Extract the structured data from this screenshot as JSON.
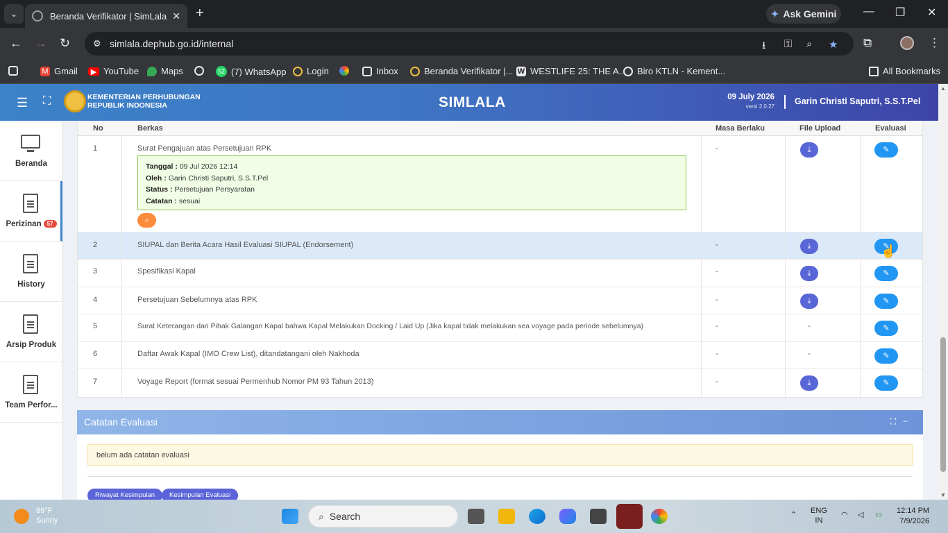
{
  "browser": {
    "tab_title": "Beranda Verifikator | SimLala",
    "new_tab": "+",
    "gemini_label": "Ask Gemini",
    "url": "simlala.dephub.go.id/internal",
    "bookmarks": [
      {
        "label": "Gmail"
      },
      {
        "label": "YouTube"
      },
      {
        "label": "Maps"
      },
      {
        "label": ""
      },
      {
        "label": "(7) WhatsApp"
      },
      {
        "label": "Login"
      },
      {
        "label": ""
      },
      {
        "label": "Inbox"
      },
      {
        "label": "Beranda Verifikator |..."
      },
      {
        "label": "WESTLIFE 25: THE A..."
      },
      {
        "label": "Biro KTLN - Kement..."
      }
    ],
    "all_bookmarks": "All Bookmarks"
  },
  "header": {
    "org_line1": "KEMENTERIAN PERHUBUNGAN",
    "org_line2": "REPUBLIK INDONESIA",
    "brand": "SIMLALA",
    "date": "09 July 2026",
    "version": "versi 2.0.27",
    "user": "Garin Christi Saputri, S.S.T.Pel"
  },
  "sidebar": {
    "items": [
      {
        "label": "Beranda"
      },
      {
        "label": "Perizinan",
        "badge": "57"
      },
      {
        "label": "History"
      },
      {
        "label": "Arsip Produk"
      },
      {
        "label": "Team Perfor..."
      }
    ]
  },
  "table": {
    "columns": [
      "No",
      "Berkas",
      "Masa Berlaku",
      "File Upload",
      "Evaluasi"
    ],
    "rows": [
      {
        "no": "1",
        "berkas": "Surat Pengajuan atas Persetujuan RPK",
        "masa": "-",
        "file": "download"
      },
      {
        "no": "2",
        "berkas": "SIUPAL dan Berita Acara Hasil Evaluasi SIUPAL (Endorsement)",
        "masa": "-",
        "file": "download"
      },
      {
        "no": "3",
        "berkas": "Spesifikasi Kapal",
        "masa": "-",
        "file": "download"
      },
      {
        "no": "4",
        "berkas": "Persetujuan Sebelumnya atas RPK",
        "masa": "-",
        "file": "download"
      },
      {
        "no": "5",
        "berkas": "Surat Keterangan dari Pihak Galangan Kapal bahwa Kapal Melakukan Docking / Laid Up (Jika kapal tidak melakukan sea voyage pada periode sebelumnya)",
        "masa": "-",
        "file": "-"
      },
      {
        "no": "6",
        "berkas": "Daftar Awak Kapal (IMO Crew List), ditandatangani oleh Nakhoda",
        "masa": "-",
        "file": "-"
      },
      {
        "no": "7",
        "berkas": "Voyage Report (format sesuai Permenhub Nomor PM 93 Tahun 2013)",
        "masa": "-",
        "file": "download"
      }
    ],
    "note": {
      "tanggal_label": "Tanggal :",
      "tanggal": "09 Jul 2026 12:14",
      "oleh_label": "Oleh :",
      "oleh": "Garin Christi Saputri, S.S.T.Pel",
      "status_label": "Status :",
      "status": "Persetujuan Persyaratan",
      "catatan_label": "Catatan :",
      "catatan": "sesuai"
    }
  },
  "catatan": {
    "title": "Catatan Evaluasi",
    "empty": "belum ada catatan evaluasi",
    "btn_riwayat": "Riwayat Kesimpulan",
    "btn_kesimpulan": "Kesimpulan Evaluasi"
  },
  "taskbar": {
    "temp": "89°F",
    "weather": "Sunny",
    "search": "Search",
    "lang1": "ENG",
    "lang2": "IN",
    "time": "12:14 PM",
    "date": "7/9/2026"
  }
}
